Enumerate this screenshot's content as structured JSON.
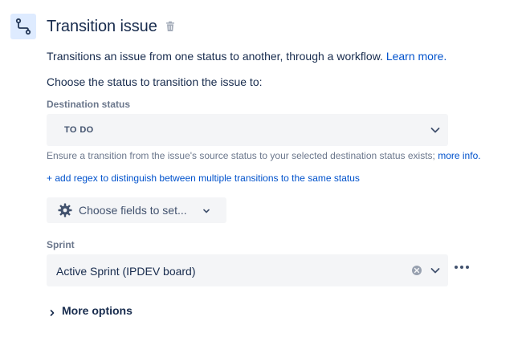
{
  "header": {
    "title": "Transition issue",
    "step_icon": "transition-icon",
    "delete_icon": "trash-icon"
  },
  "description": {
    "text": "Transitions an issue from one status to another, through a workflow.",
    "link": "Learn more."
  },
  "prompt": "Choose the status to transition the issue to:",
  "destination": {
    "label": "Destination status",
    "value": "TO DO",
    "helper_text": "Ensure a transition from the issue's source status to your selected destination status exists;",
    "helper_link": "more info.",
    "regex_link": "+ add regex to distinguish between multiple transitions to the same status"
  },
  "choose_fields": {
    "label": "Choose fields to set...",
    "icon": "gear-icon"
  },
  "sprint": {
    "label": "Sprint",
    "value": "Active Sprint (IPDEV board)"
  },
  "more_options": {
    "label": "More options"
  },
  "colors": {
    "accent": "#0052cc",
    "text": "#172b4d",
    "muted": "#6b778c",
    "field_bg": "#f4f5f7",
    "icon_bg": "#deebff"
  }
}
